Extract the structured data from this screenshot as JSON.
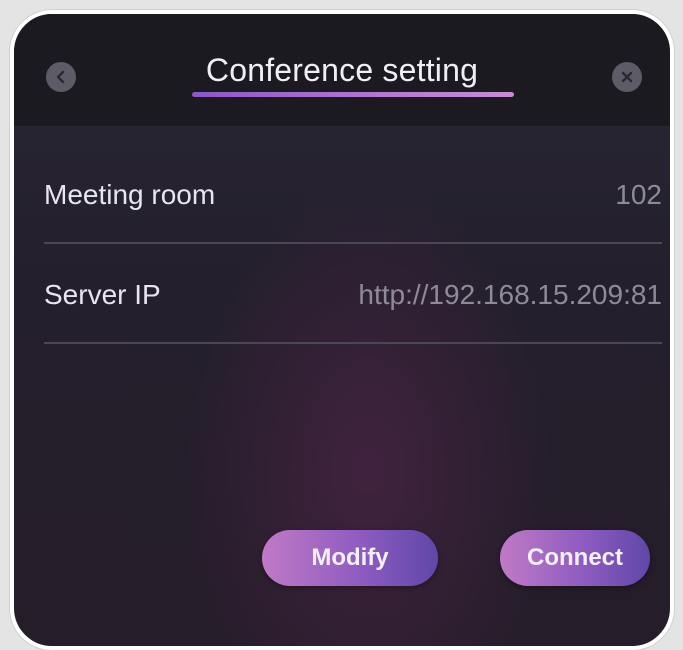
{
  "dialog": {
    "title": "Conference setting",
    "back_icon": "chevron-left-icon",
    "close_icon": "close-icon"
  },
  "fields": [
    {
      "label": "Meeting room",
      "value": "102"
    },
    {
      "label": "Server IP",
      "value": "http://192.168.15.209:81"
    }
  ],
  "actions": {
    "modify_label": "Modify",
    "connect_label": "Connect"
  },
  "colors": {
    "accent_start": "#c07ac6",
    "accent_end": "#5f47a8",
    "header_bg": "#1b1a21",
    "panel_bg": "#2b2836"
  }
}
